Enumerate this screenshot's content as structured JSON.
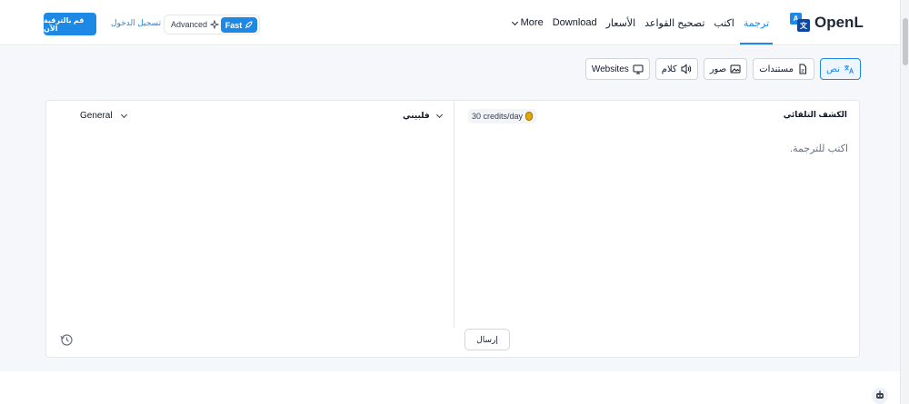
{
  "header": {
    "signup_label": "قم بالترقية الآن",
    "login_label": "تسجيل الدخول",
    "mode_advanced": "Advanced",
    "mode_fast": "Fast",
    "nav": {
      "translate": "ترجمة",
      "write": "اكتب",
      "grammar": "تصحيح القواعد",
      "pricing": "الأسعار",
      "download": "Download",
      "more": "More"
    },
    "logo_text": "OpenL",
    "logo_a": "A",
    "logo_b": "文"
  },
  "tabs": {
    "text": "نص",
    "documents": "مستندات",
    "images": "صور",
    "speech": "كلام",
    "websites": "Websites"
  },
  "panel": {
    "style_value": "General",
    "target_language": "فلبيني",
    "credits_label": "30 credits/day",
    "detect_language": "الكشف التلقائي",
    "source_placeholder": "اكتب للترجمة.",
    "send_label": "إرسال"
  },
  "colors": {
    "accent": "#1e88e5",
    "border": "#e5e7eb",
    "background": "#f5f7fa"
  }
}
